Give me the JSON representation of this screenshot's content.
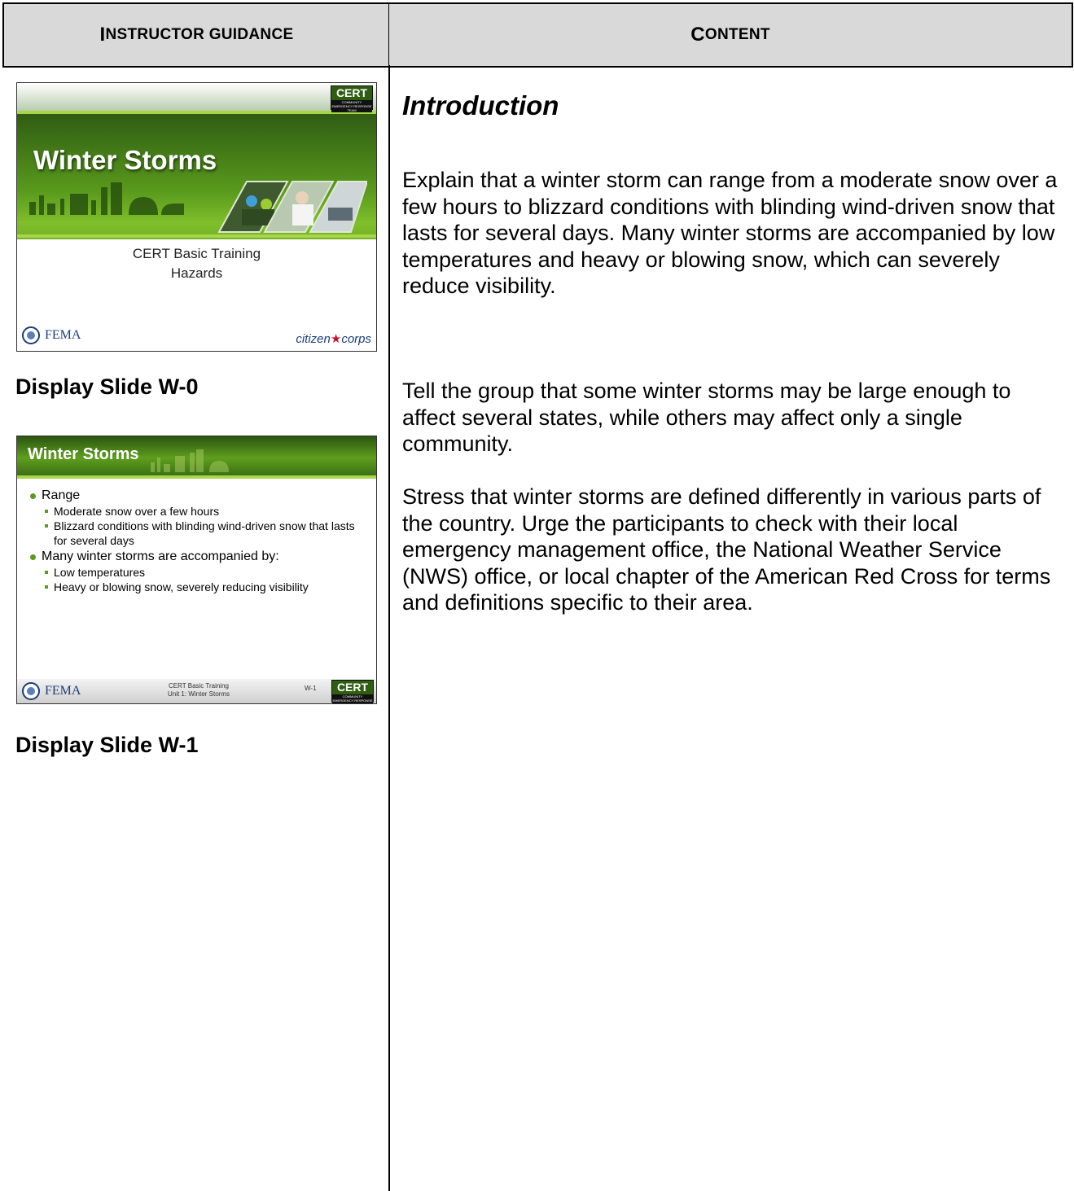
{
  "header": {
    "left": {
      "cap": "I",
      "rest": "NSTRUCTOR GUIDANCE"
    },
    "right": {
      "cap": "C",
      "rest": "ONTENT"
    }
  },
  "slide0": {
    "title": "Winter Storms",
    "subtitle_1": "CERT Basic Training",
    "subtitle_2": "Hazards",
    "fema": "FEMA",
    "citizen": "citizen",
    "corps": "corps",
    "cert_logo": "CERT",
    "cert_logo_sub": "COMMUNITY EMERGENCY RESPONSE TEAM",
    "caption": "Display Slide W-0"
  },
  "slide1": {
    "title": "Winter Storms",
    "bullets": [
      {
        "text": "Range",
        "sub": [
          "Moderate snow over a few hours",
          "Blizzard conditions with blinding wind-driven snow that lasts for several days"
        ]
      },
      {
        "text": "Many winter storms are accompanied by:",
        "sub": [
          "Low temperatures",
          "Heavy or blowing snow, severely reducing visibility"
        ]
      }
    ],
    "footer_line_1": "CERT Basic Training",
    "footer_line_2": "Unit 1: Winter Storms",
    "slide_number": "W-1",
    "fema": "FEMA",
    "cert_logo": "CERT",
    "cert_logo_sub": "COMMUNITY EMERGENCY RESPONSE TEAM",
    "caption": "Display Slide W-1"
  },
  "content": {
    "heading": "Introduction",
    "paragraphs": [
      "Explain that a winter storm can range from a moderate snow over a few hours to blizzard conditions with blinding wind-driven snow that lasts for several days. Many winter storms are accompanied by low temperatures and heavy or blowing snow, which can severely reduce visibility.",
      "Tell the group that some winter storms may be large enough to affect several states, while others may affect only a single community.",
      "Stress that winter storms are defined differently in various parts of the country.  Urge the participants to check with their local emergency management office, the National Weather Service (NWS) office, or local chapter of the American Red Cross for terms and definitions specific to their area."
    ]
  }
}
